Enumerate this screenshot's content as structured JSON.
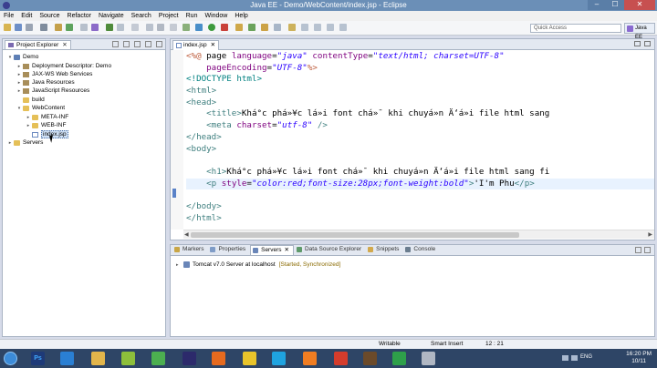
{
  "window": {
    "title": "Java EE - Demo/WebContent/index.jsp - Eclipse",
    "min": "–",
    "max": "☐",
    "close": "✕"
  },
  "menu": [
    "File",
    "Edit",
    "Source",
    "Refactor",
    "Navigate",
    "Search",
    "Project",
    "Run",
    "Window",
    "Help"
  ],
  "quick_access": {
    "placeholder": "Quick Access"
  },
  "perspective": "Java EE",
  "project_explorer": {
    "tab_label": "Project Explorer",
    "close": "✕",
    "tree": [
      {
        "label": "Demo",
        "arrow": "▾",
        "icon": "project"
      },
      {
        "label": "Deployment Descriptor: Demo",
        "arrow": "▸",
        "icon": "descriptor"
      },
      {
        "label": "JAX-WS Web Services",
        "arrow": "▸",
        "icon": "webservices"
      },
      {
        "label": "Java Resources",
        "arrow": "▸",
        "icon": "java-resources"
      },
      {
        "label": "JavaScript Resources",
        "arrow": "▸",
        "icon": "js-resources"
      },
      {
        "label": "build",
        "arrow": "",
        "icon": "folder"
      },
      {
        "label": "WebContent",
        "arrow": "▾",
        "icon": "folder"
      },
      {
        "label": "META-INF",
        "arrow": "▸",
        "icon": "folder"
      },
      {
        "label": "WEB-INF",
        "arrow": "▸",
        "icon": "folder"
      },
      {
        "label": "index.jsp",
        "arrow": "",
        "icon": "jsp-file",
        "selected": true
      },
      {
        "label": "Servers",
        "arrow": "▸",
        "icon": "folder"
      }
    ]
  },
  "editor": {
    "tab_label": "index.jsp",
    "close": "✕",
    "lines": [
      [
        [
          "dir",
          "<%@ "
        ],
        [
          "plain",
          "page "
        ],
        [
          "attr",
          "language"
        ],
        [
          "plain",
          "="
        ],
        [
          "val",
          "\"java\""
        ],
        [
          "plain",
          " "
        ],
        [
          "attr",
          "contentType"
        ],
        [
          "plain",
          "="
        ],
        [
          "val",
          "\"text/html; charset=UTF-8\""
        ]
      ],
      [
        [
          "plain",
          "    "
        ],
        [
          "attr",
          "pageEncoding"
        ],
        [
          "plain",
          "="
        ],
        [
          "val",
          "\"UTF-8\""
        ],
        [
          "dir",
          "%>"
        ]
      ],
      [
        [
          "doc",
          "<!DOCTYPE html>"
        ]
      ],
      [
        [
          "tag",
          "<html>"
        ]
      ],
      [
        [
          "tag",
          "<head>"
        ]
      ],
      [
        [
          "plain",
          "    "
        ],
        [
          "tag",
          "<title>"
        ],
        [
          "plain",
          "Khá°c phá»¥c lá»i font chá»¯ khi chuyá»n Ä‘á»i file html sang"
        ]
      ],
      [
        [
          "plain",
          "    "
        ],
        [
          "tag",
          "<meta "
        ],
        [
          "attr",
          "charset"
        ],
        [
          "plain",
          "="
        ],
        [
          "val",
          "\"utf-8\""
        ],
        [
          "tag",
          " />"
        ]
      ],
      [
        [
          "tag",
          "</head>"
        ]
      ],
      [
        [
          "tag",
          "<body>"
        ]
      ],
      [
        [
          "plain",
          ""
        ]
      ],
      [
        [
          "plain",
          "    "
        ],
        [
          "tag",
          "<h1>"
        ],
        [
          "plain",
          "Khá°c phá»¥c lá»i font chá»¯ khi chuyá»n Ä‘á»i file html sang fi"
        ]
      ],
      [
        [
          "plain",
          "    "
        ],
        [
          "tag",
          "<p "
        ],
        [
          "attr",
          "style"
        ],
        [
          "plain",
          "="
        ],
        [
          "val",
          "\"color:red;font-size:28px;font-weight:bold\""
        ],
        [
          "tag",
          ">"
        ],
        [
          "plain",
          "'I'm Phu"
        ],
        [
          "tag",
          "</p>"
        ]
      ],
      [
        [
          "plain",
          ""
        ]
      ],
      [
        [
          "tag",
          "</body>"
        ]
      ],
      [
        [
          "tag",
          "</html>"
        ]
      ]
    ]
  },
  "bottom_panel": {
    "tabs": [
      {
        "label": "Markers",
        "active": false,
        "color": "#c9a646"
      },
      {
        "label": "Properties",
        "active": false,
        "color": "#7f9cc7"
      },
      {
        "label": "Servers",
        "active": true,
        "color": "#6a86b8",
        "close": "✕"
      },
      {
        "label": "Data Source Explorer",
        "active": false,
        "color": "#5f9a6b"
      },
      {
        "label": "Snippets",
        "active": false,
        "color": "#d2a94d"
      },
      {
        "label": "Console",
        "active": false,
        "color": "#6b7d8f"
      }
    ],
    "server": {
      "name": "Tomcat v7.0 Server at localhost",
      "status": "[Started, Synchronized]"
    }
  },
  "status_bar": {
    "mode": "Writable",
    "insert": "Smart Insert",
    "position": "12 : 21"
  },
  "taskbar": {
    "apps": [
      {
        "name": "photoshop-icon",
        "color": "#1e3a78",
        "label": "Ps"
      },
      {
        "name": "internet-explorer-icon",
        "color": "#2a7fd3"
      },
      {
        "name": "folder-icon",
        "color": "#e2b54b"
      },
      {
        "name": "android-icon",
        "color": "#8dbf3b"
      },
      {
        "name": "android-studio-icon",
        "color": "#4caf50"
      },
      {
        "name": "eclipse-icon",
        "color": "#2c2a6b"
      },
      {
        "name": "firefox-icon",
        "color": "#e66a1f"
      },
      {
        "name": "chrome-icon",
        "color": "#e8c42b"
      },
      {
        "name": "skype-icon",
        "color": "#1fa3e0"
      },
      {
        "name": "xampp-icon",
        "color": "#f07d22"
      },
      {
        "name": "app-red-icon",
        "color": "#d43c2c"
      },
      {
        "name": "app-dark-icon",
        "color": "#6b4a2a"
      },
      {
        "name": "app-green-icon",
        "color": "#2ea04a"
      },
      {
        "name": "app-misc-icon",
        "color": "#b0b7c3"
      }
    ],
    "lang": "ENG",
    "time": "16:20 PM",
    "date": "10/11"
  }
}
